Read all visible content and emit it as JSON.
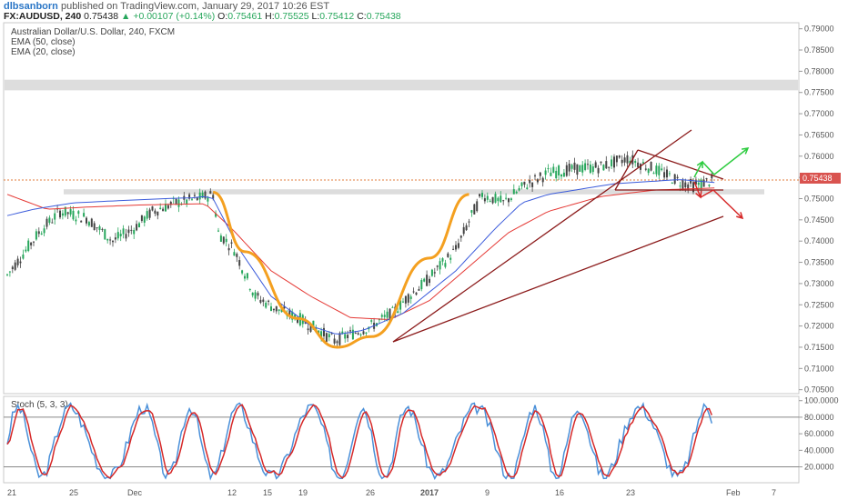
{
  "header": {
    "author": "dlbsanborn",
    "published_text": "published on TradingView.com, January 29, 2017 10:26 EST",
    "symbol": "FX:AUDUSD, 240",
    "last": "0.75438",
    "change": "+0.00107 (+0.14%)",
    "open_label": "O:",
    "open": "0.75461",
    "high_label": "H:",
    "high": "0.75525",
    "low_label": "L:",
    "low": "0.75412",
    "close_label": "C:",
    "close": "0.75438"
  },
  "legend": {
    "line1": "Australian Dollar/U.S. Dollar, 240, FXCM",
    "line2": "EMA (50, close)",
    "line3": "EMA (20, close)",
    "stoch": "Stoch (5, 3, 3)"
  },
  "price_label": "0.75438",
  "colors": {
    "candle_up": "#26a65b",
    "candle_down": "#444444",
    "ema20": "#3b5bdb",
    "ema50": "#e53935",
    "cup": "#f4a020",
    "trend": "#8b1a1a",
    "green_arrow": "#2ecc40",
    "red_arrow": "#d62828",
    "stoch_k": "#4a90d9",
    "stoch_d": "#d62828",
    "price_line": "#e07b39"
  },
  "chart_data": {
    "type": "candlestick",
    "price_axis": {
      "ylim": [
        0.7045,
        0.791
      ],
      "ticks": [
        "0.79000",
        "0.78500",
        "0.78000",
        "0.77500",
        "0.77000",
        "0.76500",
        "0.76000",
        "0.75500",
        "0.75000",
        "0.74500",
        "0.74000",
        "0.73500",
        "0.73000",
        "0.72500",
        "0.72000",
        "0.71500",
        "0.71000",
        "0.70500"
      ]
    },
    "stoch_axis": {
      "ylim": [
        3,
        103
      ],
      "ticks": [
        "100.0000",
        "80.0000",
        "60.0000",
        "40.0000",
        "20.0000"
      ]
    },
    "x_ticks": [
      "21",
      "25",
      "Dec",
      "12",
      "15",
      "19",
      "26",
      "2017",
      "9",
      "16",
      "23",
      "Feb",
      "7"
    ],
    "ema20_path": [
      [
        0,
        0.746
      ],
      [
        10,
        0.7475
      ],
      [
        25,
        0.749
      ],
      [
        45,
        0.7496
      ],
      [
        60,
        0.75
      ],
      [
        70,
        0.7502
      ],
      [
        75,
        0.7505
      ],
      [
        78,
        0.75
      ],
      [
        88,
        0.738
      ],
      [
        100,
        0.727
      ],
      [
        115,
        0.72
      ],
      [
        125,
        0.718
      ],
      [
        135,
        0.719
      ],
      [
        150,
        0.723
      ],
      [
        170,
        0.733
      ],
      [
        185,
        0.743
      ],
      [
        195,
        0.749
      ],
      [
        205,
        0.751
      ],
      [
        230,
        0.7535
      ],
      [
        255,
        0.7545
      ],
      [
        268,
        0.7538
      ]
    ],
    "ema50_path": [
      [
        0,
        0.751
      ],
      [
        15,
        0.7475
      ],
      [
        30,
        0.748
      ],
      [
        50,
        0.7485
      ],
      [
        75,
        0.7488
      ],
      [
        85,
        0.743
      ],
      [
        100,
        0.733
      ],
      [
        115,
        0.727
      ],
      [
        130,
        0.722
      ],
      [
        145,
        0.7215
      ],
      [
        160,
        0.726
      ],
      [
        175,
        0.734
      ],
      [
        190,
        0.742
      ],
      [
        205,
        0.747
      ],
      [
        225,
        0.7505
      ],
      [
        245,
        0.752
      ],
      [
        268,
        0.7525
      ]
    ],
    "cup_curve": [
      [
        78,
        0.7515
      ],
      [
        90,
        0.7375
      ],
      [
        110,
        0.7218
      ],
      [
        125,
        0.715
      ],
      [
        138,
        0.7175
      ],
      [
        160,
        0.736
      ],
      [
        175,
        0.751
      ]
    ],
    "support_zones": [
      {
        "from": 0.751,
        "to": 0.7522
      },
      {
        "from": 0.7755,
        "to": 0.778
      }
    ]
  }
}
